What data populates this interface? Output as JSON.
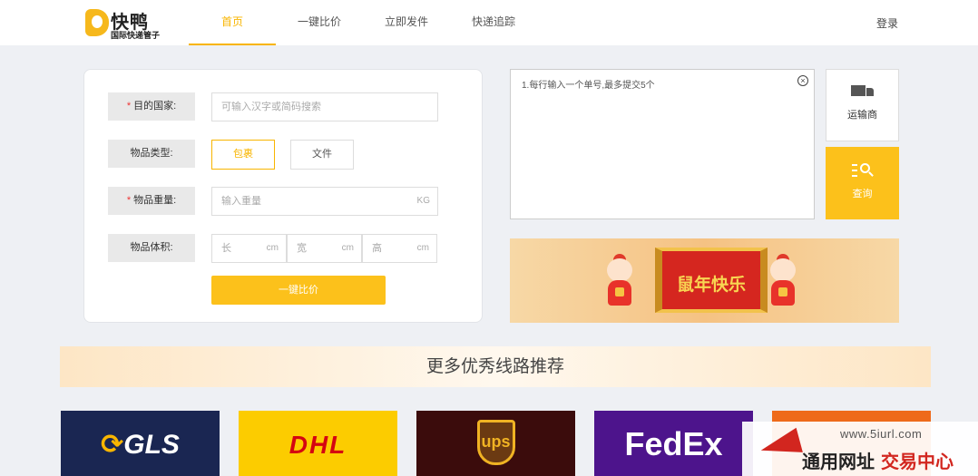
{
  "header": {
    "logo_name": "快鸭",
    "logo_tagline": "国际快递管子",
    "nav": [
      "首页",
      "一键比价",
      "立即发件",
      "快递追踪"
    ],
    "active_nav": 0,
    "login_label": "登录"
  },
  "form": {
    "destination": {
      "label": "目的国家:",
      "required": true,
      "placeholder": "可输入汉字或简码搜索"
    },
    "item_type": {
      "label": "物品类型:",
      "options": [
        "包裹",
        "文件"
      ],
      "selected": "包裹"
    },
    "weight": {
      "label": "物品重量:",
      "required": true,
      "placeholder": "输入重量",
      "unit": "KG"
    },
    "volume": {
      "label": "物品体积:",
      "fields": [
        {
          "placeholder": "长",
          "unit": "cm"
        },
        {
          "placeholder": "宽",
          "unit": "cm"
        },
        {
          "placeholder": "高",
          "unit": "cm"
        }
      ]
    },
    "submit_label": "一键比价"
  },
  "tracking": {
    "placeholder": "1.每行输入一个单号,最多提交5个",
    "carrier_label": "运输商",
    "query_label": "查询"
  },
  "banner": {
    "text": "鼠年快乐"
  },
  "section": {
    "title": "更多优秀线路推荐"
  },
  "carriers": [
    {
      "name": "GLS",
      "bg": "#1a2652",
      "color": "#f8b500"
    },
    {
      "name": "DHL",
      "bg": "#fccc00",
      "color": "#d40511"
    },
    {
      "name": "ups",
      "bg": "#3b0c0c",
      "color": "#f0b323"
    },
    {
      "name": "FedEx",
      "bg": "#4d148c",
      "color": "#ffffff"
    },
    {
      "name": "",
      "bg": "#ee6a1a",
      "color": "#ffffff"
    }
  ],
  "watermark": {
    "url": "www.5iurl.com",
    "text_a": "通用网址",
    "text_b": "交易中心"
  }
}
